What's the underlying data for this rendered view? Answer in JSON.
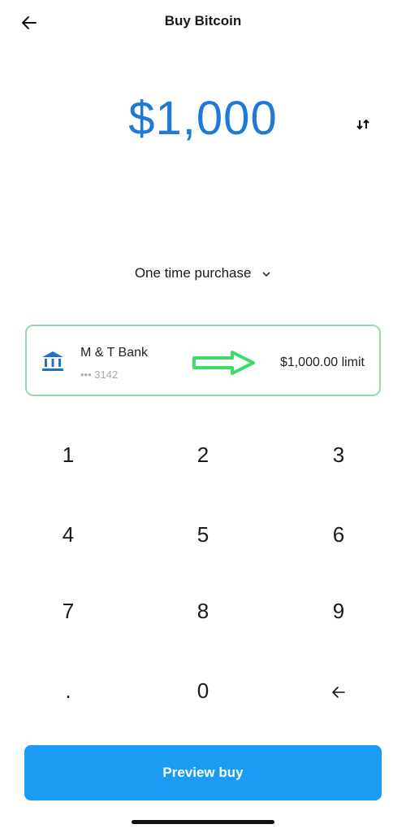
{
  "header": {
    "title": "Buy Bitcoin",
    "back_icon": "arrow-left-icon"
  },
  "amount": {
    "value": "$1,000",
    "swap_icon": "swap-arrows-icon",
    "accent_color": "#1f7ad6"
  },
  "purchase_type": {
    "selected": "One time purchase",
    "chevron": "⌄"
  },
  "payment_method": {
    "bank_name": "M & T Bank",
    "account_masked": "••• 3142",
    "limit": "$1,000.00 limit",
    "icon": "bank-icon"
  },
  "keypad": {
    "keys": [
      "1",
      "2",
      "3",
      "4",
      "5",
      "6",
      "7",
      "8",
      "9",
      ".",
      "0",
      "←"
    ]
  },
  "preview_button": {
    "label": "Preview buy",
    "color": "#1a9cf5"
  }
}
